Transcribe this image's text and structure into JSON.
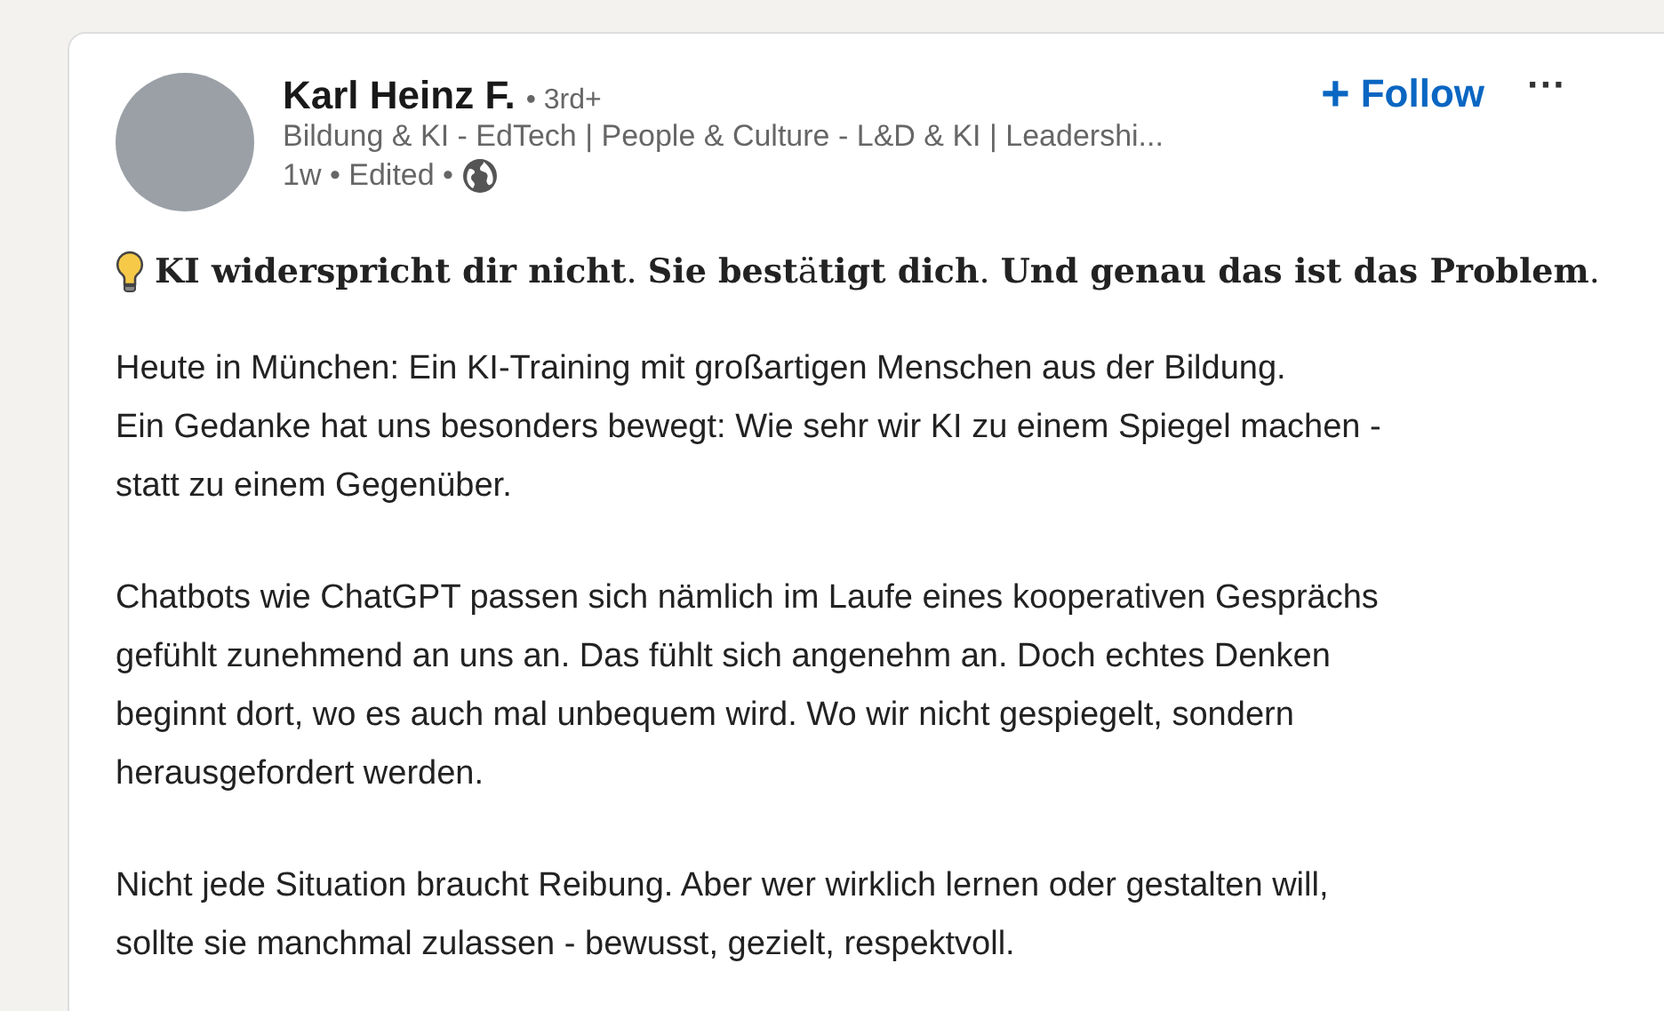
{
  "post": {
    "author": {
      "name": "Karl Heinz F.",
      "degree": "• 3rd+",
      "headline": "Bildung & KI - EdTech | People & Culture - L&D & KI | Leadershi...",
      "meta": "1w • Edited •"
    },
    "follow_button": {
      "icon": "+",
      "label": "Follow"
    },
    "more_button": "···",
    "headline": "**KI widerspricht dir nicht**. **Sie best**ä**tigt dich**. **Und genau das ist das Problem**.",
    "paragraphs": [
      "Heute in München: Ein KI-Training mit großartigen Menschen aus der Bildung.\nEin Gedanke hat uns besonders bewegt: Wie sehr wir KI zu einem Spiegel machen -\nstatt zu einem Gegenüber.",
      "Chatbots wie ChatGPT passen sich nämlich im Laufe eines kooperativen Gesprächs\ngefühlt zunehmend an uns an. Das fühlt sich angenehm an. Doch echtes Denken\nbeginnt dort, wo es auch mal unbequem wird. Wo wir nicht gespiegelt, sondern\nherausgefordert werden.",
      "Nicht jede Situation braucht Reibung. Aber wer wirklich lernen oder gestalten will,\nsollte sie manchmal zulassen - bewusst, gezielt, respektvoll."
    ]
  }
}
